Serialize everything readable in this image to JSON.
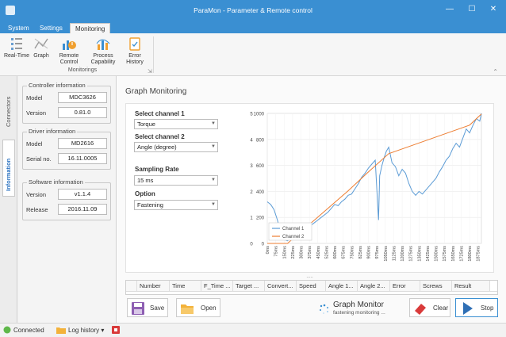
{
  "window": {
    "title": "ParaMon - Parameter & Remote control",
    "minimize_glyph": "—",
    "maximize_glyph": "☐",
    "close_glyph": "✕"
  },
  "ribbon_tabs": [
    "System",
    "Settings",
    "Monitoring"
  ],
  "ribbon": {
    "buttons": [
      {
        "label": "Real-Time",
        "icon": "realtime-icon"
      },
      {
        "label": "Graph",
        "icon": "graph-icon"
      },
      {
        "label": "Remote Control",
        "icon": "remote-control-icon"
      },
      {
        "label": "Process Capability",
        "icon": "process-capability-icon"
      },
      {
        "label": "Error History",
        "icon": "error-history-icon"
      }
    ],
    "group_label": "Monitorings"
  },
  "side_tabs": [
    "Connectors",
    "Information"
  ],
  "controller": {
    "title": "Controller information",
    "model_label": "Model",
    "model": "MDC3626",
    "version_label": "Version",
    "version": "0.81.0"
  },
  "driver": {
    "title": "Driver information",
    "model_label": "Model",
    "model": "MD2616",
    "serial_label": "Serial no.",
    "serial": "16.11.0005"
  },
  "software": {
    "title": "Software information",
    "version_label": "Version",
    "version": "v1.1.4",
    "release_label": "Release",
    "release": "2016.11.09"
  },
  "graph": {
    "section_title": "Graph Monitoring",
    "channel1_label": "Select channel 1",
    "channel1_value": "Torque",
    "channel2_label": "Select channel 2",
    "channel2_value": "Angle (degree)",
    "sampling_label": "Sampling Rate",
    "sampling_value": "15 ms",
    "option_label": "Option",
    "option_value": "Fastening"
  },
  "chart_data": {
    "type": "line",
    "title": "",
    "xlabel": "",
    "x_tick_labels": [
      "0ms",
      "75ms",
      "150ms",
      "225ms",
      "300ms",
      "375ms",
      "450ms",
      "525ms",
      "600ms",
      "675ms",
      "750ms",
      "825ms",
      "900ms",
      "975ms",
      "1050ms",
      "1125ms",
      "1200ms",
      "1275ms",
      "1350ms",
      "1425ms",
      "1500ms",
      "1575ms",
      "1650ms",
      "1725ms",
      "1800ms",
      "1875ms"
    ],
    "left_axis": {
      "min": 0,
      "max": 1000,
      "ticks": [
        0,
        200,
        400,
        600,
        800,
        1000
      ]
    },
    "right_axis": {
      "min": 0,
      "max": 5,
      "ticks": [
        0,
        1,
        2,
        3,
        4,
        5
      ]
    },
    "grid": true,
    "legend_position": "bottom-left",
    "series": [
      {
        "name": "Channel 1",
        "axis": "right",
        "color": "#5b9bd5",
        "x": [
          0,
          30,
          60,
          90,
          120,
          150,
          180,
          210,
          240,
          270,
          300,
          330,
          360,
          390,
          420,
          450,
          480,
          510,
          540,
          570,
          600,
          630,
          660,
          690,
          720,
          750,
          780,
          810,
          840,
          870,
          900,
          930,
          960,
          990,
          1000,
          1020,
          1040,
          1060,
          1080,
          1110,
          1140,
          1170,
          1200,
          1230,
          1260,
          1290,
          1320,
          1350,
          1380,
          1410,
          1440,
          1470,
          1500,
          1530,
          1560,
          1590,
          1620,
          1650,
          1680,
          1710,
          1740,
          1770,
          1800,
          1830,
          1860,
          1890,
          1905
        ],
        "y": [
          1.6,
          1.5,
          1.3,
          0.9,
          0.4,
          0.15,
          0.1,
          0.2,
          0.35,
          0.5,
          0.3,
          0.45,
          0.55,
          0.7,
          0.8,
          0.9,
          1.0,
          1.1,
          1.2,
          1.35,
          1.5,
          1.45,
          1.6,
          1.7,
          1.85,
          1.9,
          2.1,
          2.3,
          2.55,
          2.7,
          2.9,
          3.05,
          3.2,
          0.9,
          2.6,
          3.0,
          3.3,
          3.55,
          3.7,
          3.1,
          2.95,
          2.6,
          2.85,
          2.7,
          2.3,
          2.0,
          1.85,
          2.0,
          1.9,
          2.05,
          2.2,
          2.35,
          2.5,
          2.75,
          2.95,
          3.2,
          3.35,
          3.65,
          3.85,
          3.7,
          4.05,
          4.4,
          4.25,
          4.55,
          4.8,
          4.7,
          5.0
        ]
      },
      {
        "name": "Channel 2",
        "axis": "left",
        "color": "#ed7d31",
        "x": [
          0,
          180,
          360,
          540,
          720,
          900,
          1080,
          1260,
          1440,
          1620,
          1800,
          1905
        ],
        "y": [
          0,
          0,
          135,
          270,
          405,
          550,
          690,
          745,
          800,
          855,
          910,
          995
        ]
      }
    ]
  },
  "table": {
    "headers": [
      "Number",
      "Time",
      "F_Time ...",
      "Target ...",
      "Convert...",
      "Speed",
      "Angle 1...",
      "Angle 2...",
      "Error",
      "Screws",
      "Result"
    ],
    "splitter_glyph": "....."
  },
  "bottom": {
    "save_label": "Save",
    "open_label": "Open",
    "monitor_title": "Graph Monitor",
    "monitor_status": "fastening monitoring ...",
    "clear_label": "Clear",
    "stop_label": "Stop"
  },
  "status": {
    "connected": "Connected",
    "log_history": "Log history",
    "dropdown_glyph": "▾"
  }
}
